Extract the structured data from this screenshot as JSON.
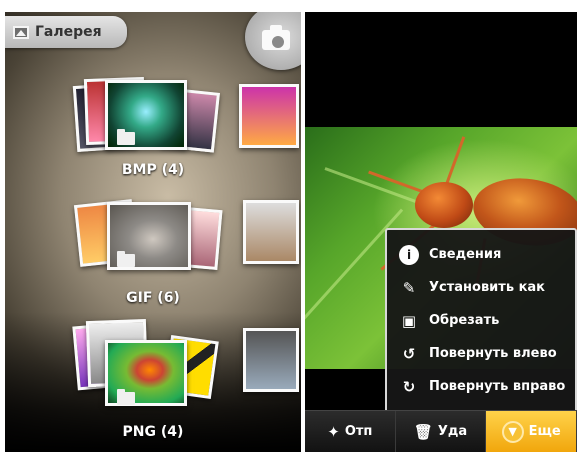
{
  "gallery": {
    "title": "Галерея",
    "camera_icon": "camera-icon",
    "albums": [
      {
        "name": "BMP",
        "count": "(4)"
      },
      {
        "name": "GIF",
        "count": "(6)"
      },
      {
        "name": "PNG",
        "count": "(4)"
      }
    ]
  },
  "viewer": {
    "context_menu": {
      "items": [
        {
          "label": "Сведения",
          "icon": "info-icon"
        },
        {
          "label": "Установить как",
          "icon": "set-as-icon"
        },
        {
          "label": "Обрезать",
          "icon": "crop-icon"
        },
        {
          "label": "Повернуть влево",
          "icon": "rotate-left-icon"
        },
        {
          "label": "Повернуть вправо",
          "icon": "rotate-right-icon"
        }
      ]
    },
    "bottom_bar": {
      "share_label": "Отп",
      "delete_label": "Уда",
      "more_label": "Еще"
    }
  },
  "colors": {
    "accent": "#f1a60c",
    "menu_background": "#161616",
    "menu_border": "#d8d8d8"
  }
}
